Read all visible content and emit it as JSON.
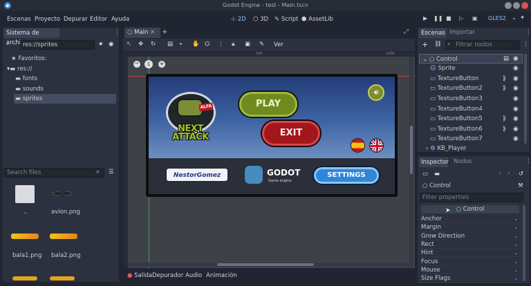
{
  "window": {
    "title": "Godot Engine - test - Main.tscn"
  },
  "menu": [
    "Escenas",
    "Proyecto",
    "Depurar",
    "Editor",
    "Ayuda"
  ],
  "workspaces": [
    "2D",
    "3D",
    "Script",
    "AssetLib"
  ],
  "renderer": "GLES2",
  "filesystem": {
    "title": "Sistema de archivos",
    "path": "res://sprites",
    "favorites_label": "Favoritos:",
    "tree": [
      "res://",
      "fonts",
      "sounds",
      "sprites"
    ],
    "search_placeholder": "Search files",
    "files": [
      {
        "name": ".."
      },
      {
        "name": "avion.png"
      },
      {
        "name": "bala1.png"
      },
      {
        "name": "bala2.png"
      }
    ]
  },
  "editor": {
    "tab": "Main",
    "toolbar_view": "Ver",
    "ruler_marks": [
      "0",
      "500",
      "1000"
    ],
    "zoom_reset": "1"
  },
  "game": {
    "badge": "ALFA",
    "title_line1": "NEXT",
    "title_line2": "ATTACK",
    "play": "PLAY",
    "exit": "EXIT",
    "author": "NestorGomez",
    "engine": "GODOT",
    "engine_sub": "Game engine",
    "settings": "SETTINGS"
  },
  "bottom": {
    "tabs": [
      "Salida",
      "Depurador",
      "Audio",
      "Animación"
    ]
  },
  "scene": {
    "tabs": [
      "Escenas",
      "Importar"
    ],
    "filter_placeholder": "Filtrar nodos",
    "nodes": [
      "Control",
      "Sprite",
      "TextureButton",
      "TextureButton2",
      "TextureButton3",
      "TextureButton4",
      "TextureButton5",
      "TextureButton6",
      "TextureButton7",
      "KB_Player"
    ]
  },
  "inspector": {
    "tabs": [
      "Inspector",
      "Nodos"
    ],
    "node": "Control",
    "filter_placeholder": "Filter properties",
    "section": "Control",
    "props": [
      "Anchor",
      "Margin",
      "Grow Direction",
      "Rect",
      "Hint",
      "Focus",
      "Mouse",
      "Size Flags"
    ]
  },
  "colors": {
    "accent": "#8ec2ff",
    "play_green": "#6f8a1e",
    "exit_red": "#a3161b",
    "settings_blue": "#2e86d9"
  }
}
